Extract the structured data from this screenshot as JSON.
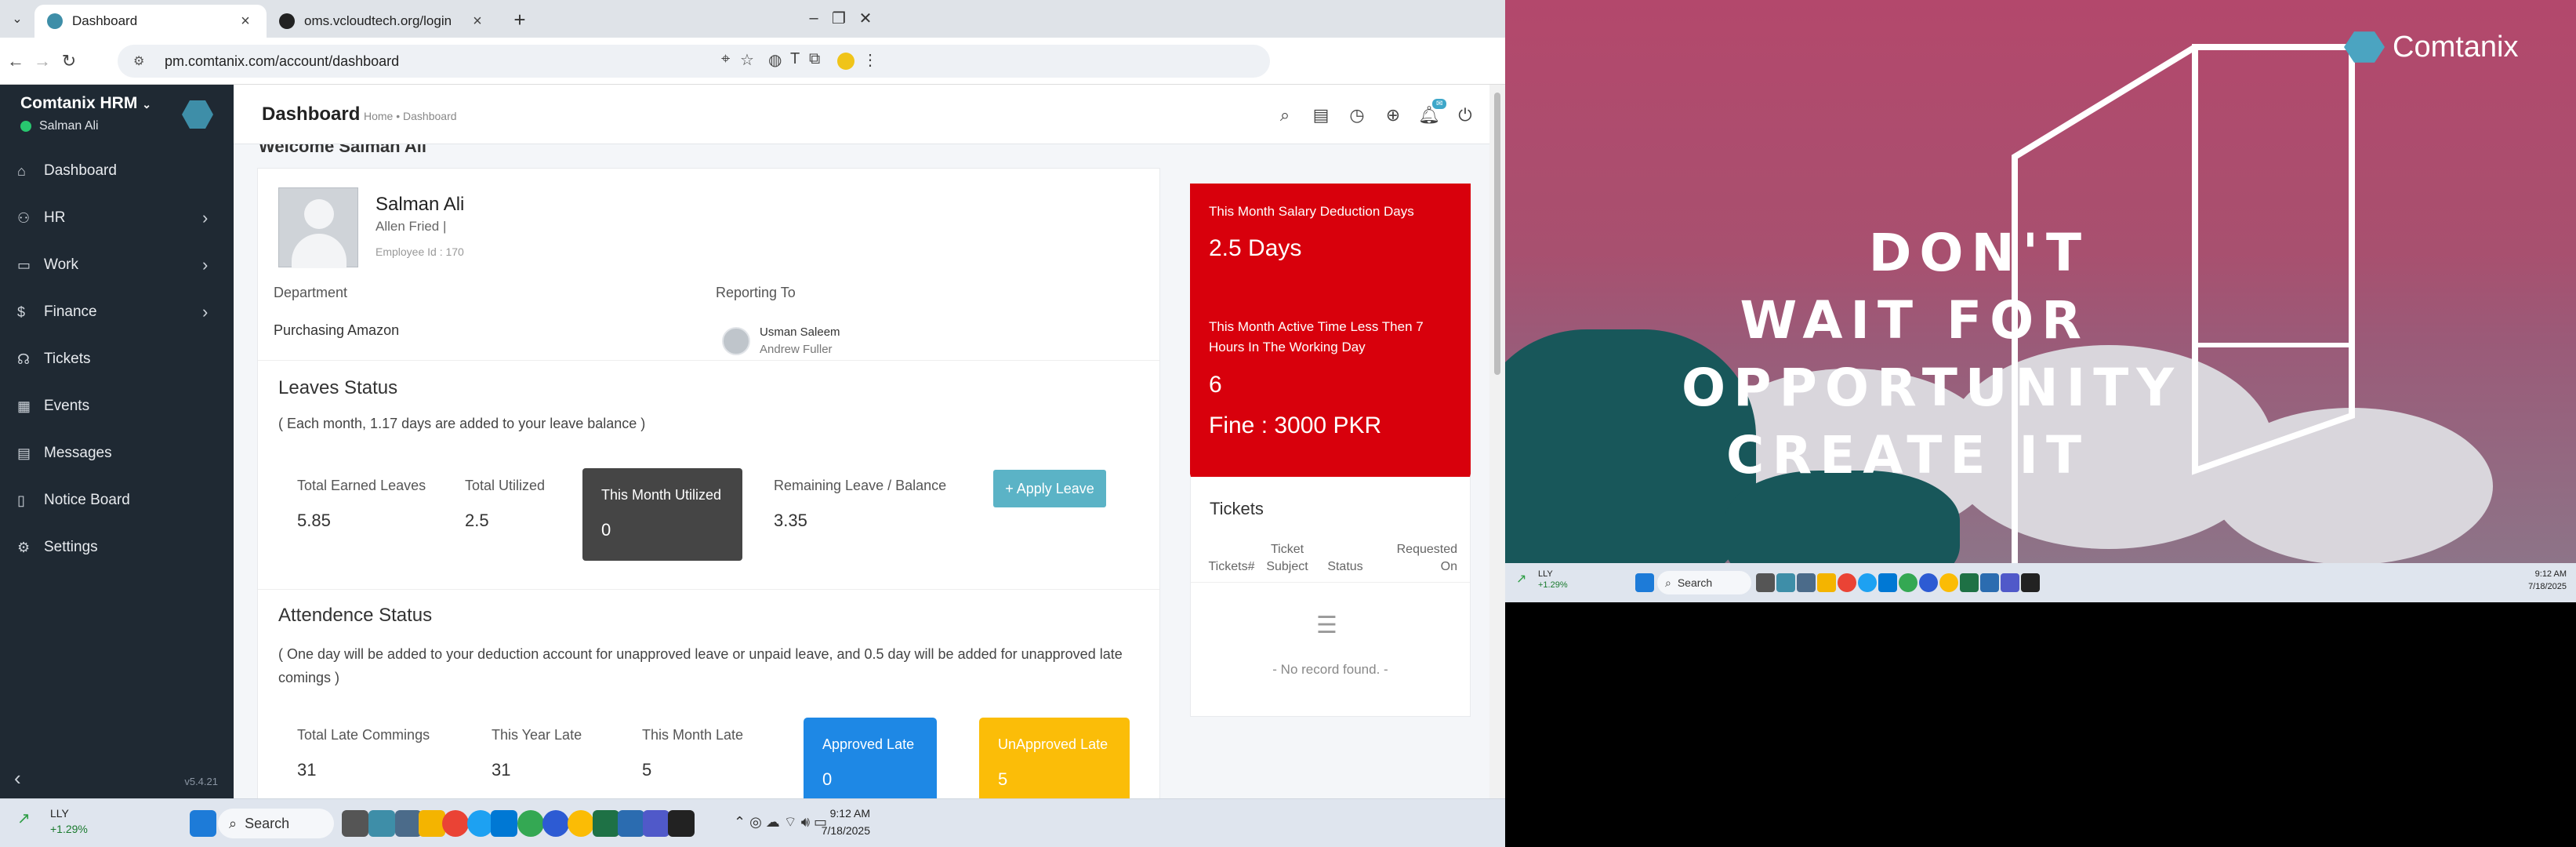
{
  "browser": {
    "tabs": [
      {
        "title": "Dashboard",
        "active": true
      },
      {
        "title": "oms.vcloudtech.org/login",
        "active": false
      }
    ],
    "url": "pm.comtanix.com/account/dashboard"
  },
  "sidebar": {
    "brand": "Comtanix HRM",
    "user": "Salman Ali",
    "items": [
      {
        "label": "Dashboard",
        "icon": "home-icon",
        "has_children": false
      },
      {
        "label": "HR",
        "icon": "users-icon",
        "has_children": true
      },
      {
        "label": "Work",
        "icon": "briefcase-icon",
        "has_children": true
      },
      {
        "label": "Finance",
        "icon": "dollar-icon",
        "has_children": true
      },
      {
        "label": "Tickets",
        "icon": "headset-icon",
        "has_children": false
      },
      {
        "label": "Events",
        "icon": "calendar-icon",
        "has_children": false
      },
      {
        "label": "Messages",
        "icon": "message-icon",
        "has_children": false
      },
      {
        "label": "Notice Board",
        "icon": "clipboard-icon",
        "has_children": false
      },
      {
        "label": "Settings",
        "icon": "gear-icon",
        "has_children": false
      }
    ],
    "version": "v5.4.21"
  },
  "header": {
    "title": "Dashboard",
    "breadcrumb": "Home • Dashboard"
  },
  "profile": {
    "welcome": "Welcome Salman Ali",
    "name": "Salman Ali",
    "company": "Allen Fried |",
    "employee_id": "Employee Id : 170",
    "department_label": "Department",
    "department": "Purchasing Amazon",
    "reporting_label": "Reporting To",
    "reporting_name": "Usman Saleem",
    "reporting_sub": "Andrew Fuller"
  },
  "leaves": {
    "title": "Leaves Status",
    "note": "( Each month, 1.17 days are added to your leave balance )",
    "earned_label": "Total Earned Leaves",
    "earned": "5.85",
    "utilized_label": "Total Utilized",
    "utilized": "2.5",
    "month_label": "This Month Utilized",
    "month": "0",
    "remaining_label": "Remaining Leave / Balance",
    "remaining": "3.35",
    "apply_label": "+ Apply Leave"
  },
  "attendance": {
    "title": "Attendence Status",
    "note": "( One day will be added to your deduction account for unapproved leave or unpaid leave, and 0.5 day will be added for unapproved late comings )",
    "late_label": "Total Late Commings",
    "late": "31",
    "year_label": "This Year Late",
    "year": "31",
    "month_label": "This Month Late",
    "month": "5",
    "approved_label": "Approved Late",
    "approved": "0",
    "unapproved_label": "UnApproved Late",
    "unapproved": "5"
  },
  "deduction": {
    "salary_label": "This Month Salary Deduction Days",
    "salary_value": "2.5 Days",
    "active_label": "This Month Active Time Less Then 7 Hours In The Working Day",
    "active_value": "6",
    "fine": "Fine : 3000 PKR"
  },
  "tickets": {
    "title": "Tickets",
    "cols": [
      "Tickets#",
      "Ticket Subject",
      "Status",
      "Requested On"
    ],
    "empty": "- No record found. -"
  },
  "taskbar": {
    "stock_ticker": "LLY",
    "stock_change": "+1.29%",
    "search": "Search",
    "time": "9:12 AM",
    "date": "7/18/2025"
  },
  "wallpaper": {
    "brand": "Comtanix",
    "quote": [
      "DON'T",
      "WAIT FOR",
      "OPPORTUNITY",
      "CREATE IT"
    ]
  },
  "taskbar2": {
    "stock_ticker": "LLY",
    "stock_change": "+1.29%",
    "search": "Search",
    "time": "9:12 AM",
    "date": "7/18/2025"
  },
  "colors": {
    "sidebar": "#1f2933",
    "accent": "#3e8ea8",
    "red_card": "#d8000c",
    "approved": "#1e88e5",
    "unapproved": "#fbbd08",
    "dark_box": "#454545",
    "apply_button": "#5bb3c6"
  }
}
